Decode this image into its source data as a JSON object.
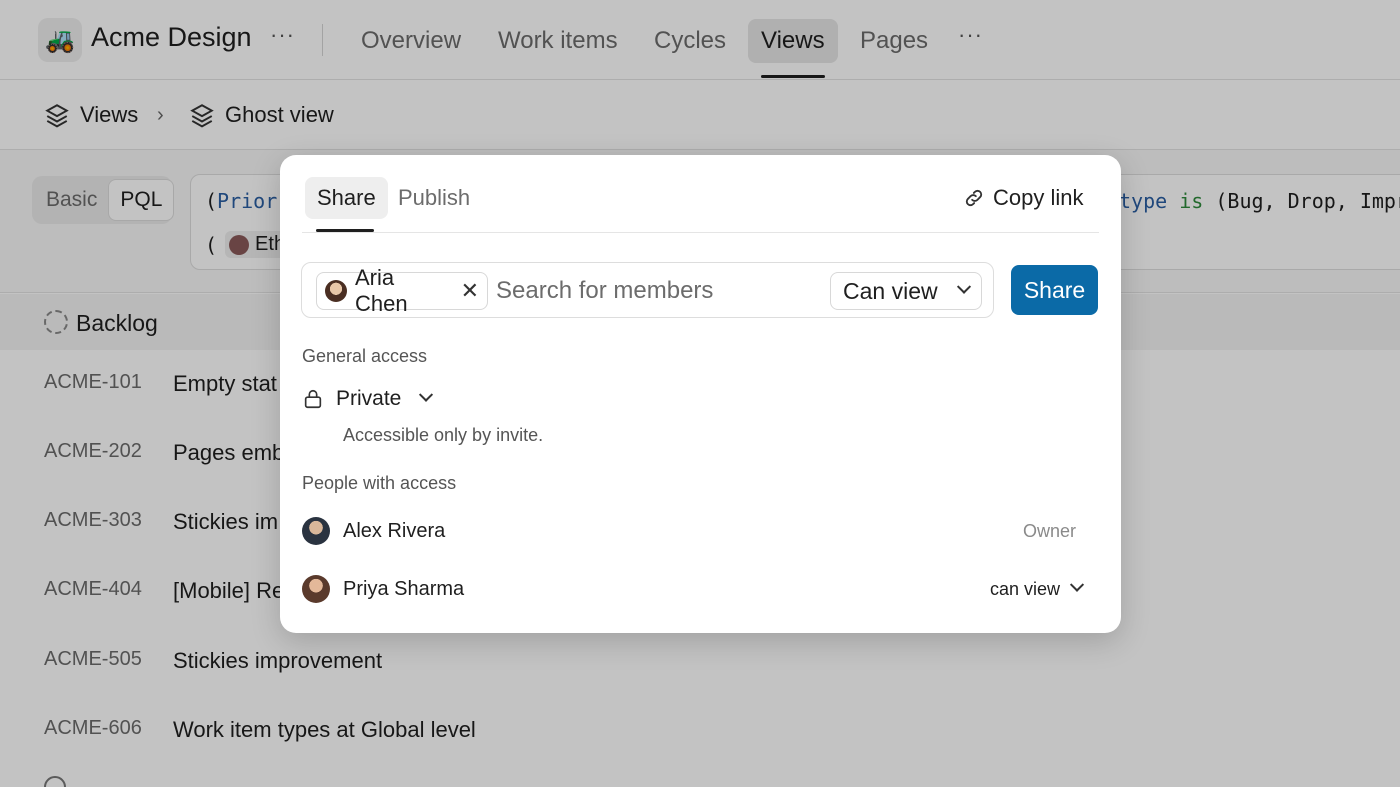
{
  "project": {
    "logo_emoji": "🚜",
    "name": "Acme Design",
    "more": "···"
  },
  "nav": {
    "tabs": [
      "Overview",
      "Work items",
      "Cycles",
      "Views",
      "Pages"
    ],
    "active": "Views",
    "more": "···"
  },
  "breadcrumb": {
    "root": "Views",
    "current": "Ghost view",
    "separator": "›"
  },
  "filter": {
    "modes": [
      "Basic",
      "PQL"
    ],
    "active_mode": "PQL",
    "query_line1_start": "(",
    "query_line1_kw": "Prior",
    "query_line1_right_kw": "type",
    "query_line1_right_op": "is",
    "query_line1_right_rest": "(Bug, Drop, Impr",
    "query_line2_start": "(",
    "query_line2_chip": "Eth"
  },
  "list": {
    "group_label": "Backlog",
    "rows": [
      {
        "id": "ACME-101",
        "title": "Empty stat"
      },
      {
        "id": "ACME-202",
        "title": "Pages emb"
      },
      {
        "id": "ACME-303",
        "title": "Stickies im"
      },
      {
        "id": "ACME-404",
        "title": "[Mobile] Re"
      },
      {
        "id": "ACME-505",
        "title": "Stickies improvement"
      },
      {
        "id": "ACME-606",
        "title": "Work item types at Global level"
      }
    ]
  },
  "share_modal": {
    "tabs": [
      "Share",
      "Publish"
    ],
    "active_tab": "Share",
    "copy_link": "Copy link",
    "invite": {
      "chip_name": "Aria Chen",
      "search_placeholder": "Search for members",
      "permission": "Can view",
      "share_button": "Share"
    },
    "general_access_label": "General access",
    "access_level": "Private",
    "access_description": "Accessible only by invite.",
    "people_label": "People with access",
    "people": [
      {
        "name": "Alex Rivera",
        "role": "Owner"
      },
      {
        "name": "Priya Sharma",
        "role": "can view"
      }
    ]
  },
  "colors": {
    "primary": "#0b6aa7",
    "overlay": "rgba(0,0,0,0.235)"
  }
}
